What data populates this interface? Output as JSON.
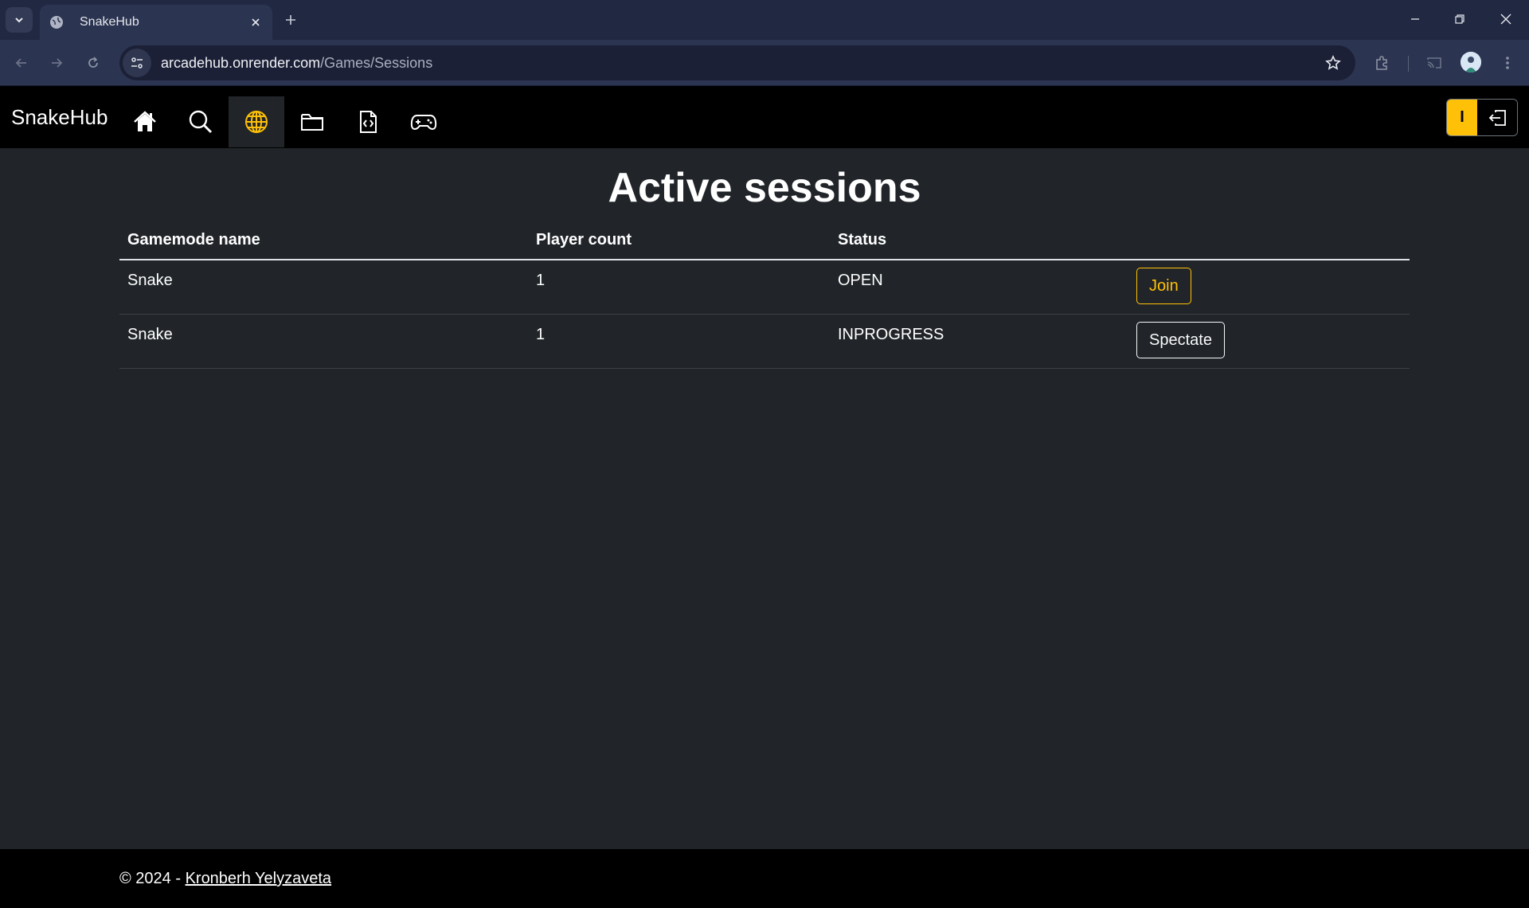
{
  "browser": {
    "tab_title": "SnakeHub",
    "url_host": "arcadehub.onrender.com",
    "url_path": "/Games/Sessions"
  },
  "navbar": {
    "brand": "SnakeHub",
    "items": [
      {
        "icon": "home-icon",
        "active": false
      },
      {
        "icon": "search-icon",
        "active": false
      },
      {
        "icon": "globe-icon",
        "active": true
      },
      {
        "icon": "folder-icon",
        "active": false
      },
      {
        "icon": "code-file-icon",
        "active": false
      },
      {
        "icon": "gamepad-icon",
        "active": false
      }
    ],
    "user_initial": "I",
    "accent_color": "#ffc107"
  },
  "main": {
    "title": "Active sessions",
    "columns": [
      "Gamemode name",
      "Player count",
      "Status",
      ""
    ],
    "rows": [
      {
        "gamemode": "Snake",
        "player_count": "1",
        "status": "OPEN",
        "action": "Join"
      },
      {
        "gamemode": "Snake",
        "player_count": "1",
        "status": "INPROGRESS",
        "action": "Spectate"
      }
    ]
  },
  "footer": {
    "copyright": "© 2024 - ",
    "author_link": "Kronberh Yelyzaveta"
  }
}
